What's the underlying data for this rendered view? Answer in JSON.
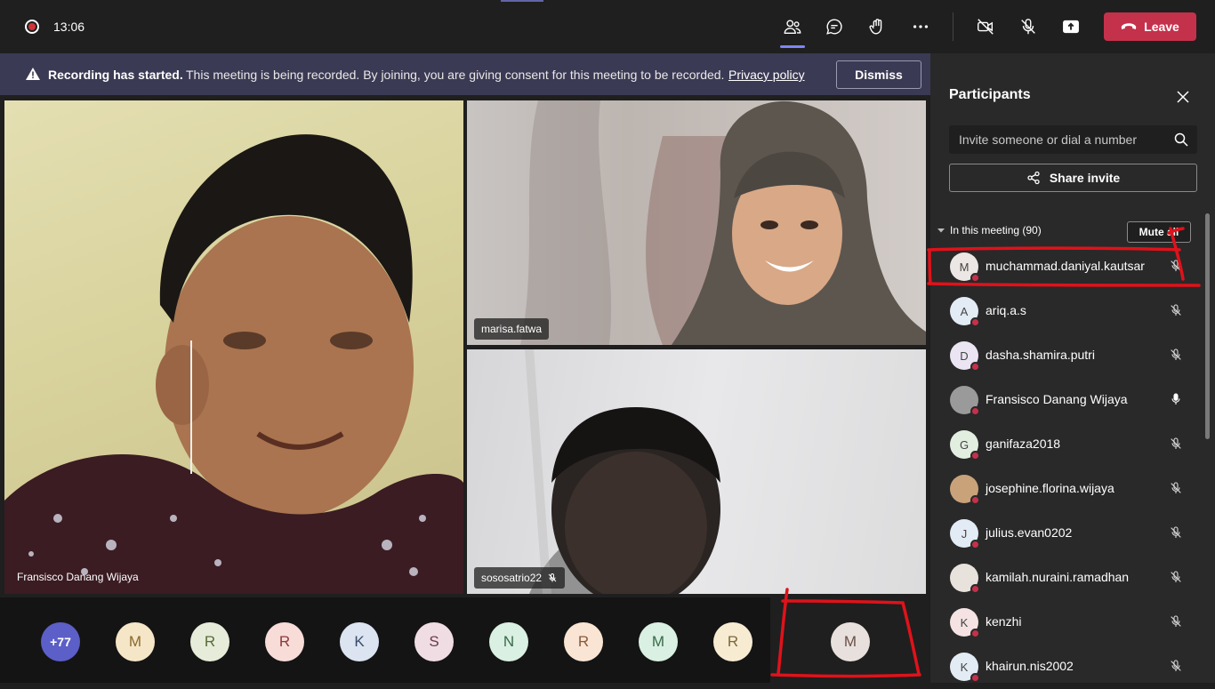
{
  "topbar": {
    "time": "13:06",
    "leave_label": "Leave",
    "icons": [
      "participants-icon",
      "chat-icon",
      "raise-hand-icon",
      "more-icon",
      "camera-off-icon",
      "mic-off-icon",
      "share-screen-icon"
    ]
  },
  "banner": {
    "title": "Recording has started.",
    "text": "This meeting is being recorded. By joining, you are giving consent for this meeting to be recorded.",
    "link": "Privacy policy",
    "dismiss_label": "Dismiss"
  },
  "videos": [
    {
      "name": "Fransisco Danang Wijaya"
    },
    {
      "name": "marisa.fatwa"
    },
    {
      "name": "sososatrio22"
    }
  ],
  "strip": {
    "overflow_count": "+77",
    "avatars": [
      {
        "initial": "M",
        "color": "#f5e6c8",
        "text": "#8a6a2a"
      },
      {
        "initial": "R",
        "color": "#e6ecd9",
        "text": "#5a6a3a"
      },
      {
        "initial": "R",
        "color": "#f8dcd8",
        "text": "#8a3a3a"
      },
      {
        "initial": "K",
        "color": "#dbe4f0",
        "text": "#3a4a6a"
      },
      {
        "initial": "S",
        "color": "#f0dde4",
        "text": "#6a3a4a"
      },
      {
        "initial": "N",
        "color": "#d9f0e2",
        "text": "#3a6a4a"
      },
      {
        "initial": "R",
        "color": "#fae5d4",
        "text": "#8a5a3a"
      },
      {
        "initial": "M",
        "color": "#d9f0e2",
        "text": "#3a6a4a"
      },
      {
        "initial": "R",
        "color": "#f7ecd2",
        "text": "#7a6a3a"
      }
    ],
    "self_initial": "M"
  },
  "panel": {
    "title": "Participants",
    "invite_placeholder": "Invite someone or dial a number",
    "share_label": "Share invite",
    "section_label": "In this meeting (90)",
    "mute_all_label": "Mute all",
    "participants": [
      {
        "name": "muchammad.daniyal.kautsar",
        "initial": "M",
        "color": "#ece7e4",
        "mic": "muted"
      },
      {
        "name": "ariq.a.s",
        "initial": "A",
        "color": "#e3ecf5",
        "mic": "muted"
      },
      {
        "name": "dasha.shamira.putri",
        "initial": "D",
        "color": "#ebe5f3",
        "mic": "muted"
      },
      {
        "name": "Fransisco Danang Wijaya",
        "initial": "",
        "color": "#9a9a9a",
        "mic": "on"
      },
      {
        "name": "ganifaza2018",
        "initial": "G",
        "color": "#e2efe0",
        "mic": "muted"
      },
      {
        "name": "josephine.florina.wijaya",
        "initial": "",
        "color": "#c9a27a",
        "mic": "muted"
      },
      {
        "name": "julius.evan0202",
        "initial": "J",
        "color": "#e3ecf5",
        "mic": "muted"
      },
      {
        "name": "kamilah.nuraini.ramadhan",
        "initial": "",
        "color": "#e8e2dc",
        "mic": "muted"
      },
      {
        "name": "kenzhi",
        "initial": "K",
        "color": "#f5e3e3",
        "mic": "muted"
      },
      {
        "name": "khairun.nis2002",
        "initial": "K",
        "color": "#e3ecf5",
        "mic": "muted"
      }
    ]
  }
}
